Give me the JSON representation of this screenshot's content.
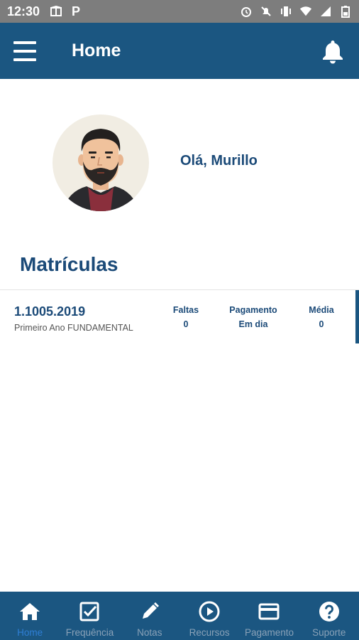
{
  "status_bar": {
    "time": "12:30",
    "p_label": "P"
  },
  "app_bar": {
    "title": "Home"
  },
  "profile": {
    "greeting": "Olá, Murillo"
  },
  "section": {
    "title": "Matrículas"
  },
  "enrollment": {
    "code": "1.1005.2019",
    "description": "Primeiro Ano FUNDAMENTAL",
    "stats": [
      {
        "label": "Faltas",
        "value": "0"
      },
      {
        "label": "Pagamento",
        "value": "Em dia"
      },
      {
        "label": "Média",
        "value": "0"
      }
    ]
  },
  "bottom_nav": {
    "items": [
      {
        "label": "Home",
        "icon": "home-icon",
        "active": true
      },
      {
        "label": "Frequência",
        "icon": "checkbox-icon"
      },
      {
        "label": "Notas",
        "icon": "pencil-icon"
      },
      {
        "label": "Recursos",
        "icon": "play-circle-icon"
      },
      {
        "label": "Pagamento",
        "icon": "credit-card-icon"
      },
      {
        "label": "Suporte",
        "icon": "help-icon"
      }
    ]
  },
  "colors": {
    "primary": "#1b5681",
    "title_text": "#1b4a78",
    "active_nav": "#2f7fd6",
    "inactive_nav": "#8aa2b8"
  }
}
